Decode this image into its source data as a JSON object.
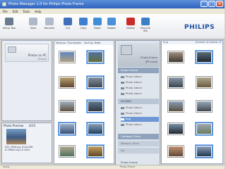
{
  "window": {
    "title": "Photo Manager 1.0 for Philips Photo Frame",
    "controls": [
      "_",
      "□",
      "×"
    ]
  },
  "menu": [
    "File",
    "Edit",
    "Tools",
    "Help"
  ],
  "toolbar": {
    "items": [
      {
        "label": "Setup Tool",
        "color": "#6a7a90"
      },
      {
        "label": "View",
        "color": "#8aa0b8"
      },
      {
        "label": "Rename",
        "color": "#9aa8c0"
      },
      {
        "label": "Cut",
        "color": "#3f6fb8"
      },
      {
        "label": "Copy",
        "color": "#3f7fd0"
      },
      {
        "label": "Paste",
        "color": "#3f8fd8"
      },
      {
        "label": "Rotate",
        "color": "#4a90d8"
      },
      {
        "label": "Delete",
        "color": "#cc2b2b"
      },
      {
        "label": "Recycle Bin",
        "color": "#3a7fc8"
      }
    ],
    "brand": "PHILIPS"
  },
  "left": {
    "label": "Photos on PC",
    "path": "(T:\\my)"
  },
  "center": {
    "view_as": "View as: Thumbnails",
    "sort_by": "Sort by: Date"
  },
  "preview": {
    "label": "Photo Preview",
    "counter": "4/15",
    "caption": "DSC_9999.jpg 1024x768 B 336KB Aug 16 2004"
  },
  "frame": {
    "title": "Photo Frame",
    "path": "(PR card)",
    "section": "Photo Frame",
    "albums": [
      "Photo Album",
      "Photo Album",
      "Photo Album",
      "Photo Album"
    ],
    "card": "ED/MMC",
    "card_albums": [
      "Photo Album",
      "Photo Album",
      "Aug",
      "Photo Album"
    ],
    "compact_flash": "Compact Flash",
    "memory_stick": "Memory Stick",
    "xd": "xD",
    "status": "Photo Frame"
  },
  "right": {
    "label": "Aug",
    "count": "Number of photos: 8"
  },
  "status": {
    "left": "ready",
    "center": "Photo Frame"
  }
}
